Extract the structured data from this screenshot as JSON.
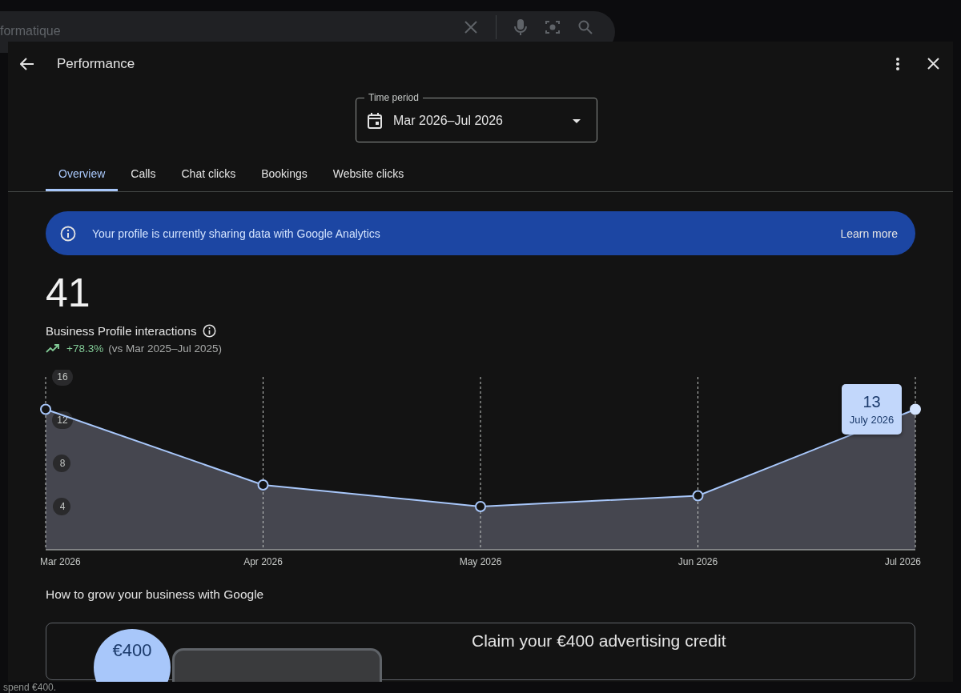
{
  "background": {
    "search_field": {
      "value": "formatique"
    },
    "footer_text": "spend €400."
  },
  "dialog": {
    "title": "Performance",
    "time_period": {
      "label": "Time period",
      "value": "Mar 2026–Jul 2026"
    },
    "tabs": [
      {
        "label": "Overview",
        "selected": true
      },
      {
        "label": "Calls",
        "selected": false
      },
      {
        "label": "Chat clicks",
        "selected": false
      },
      {
        "label": "Bookings",
        "selected": false
      },
      {
        "label": "Website clicks",
        "selected": false
      }
    ],
    "banner": {
      "text": "Your profile is currently sharing data with Google Analytics",
      "action": "Learn more"
    },
    "total": "41",
    "metric_label": "Business Profile interactions",
    "trend": {
      "change": "+78.3%",
      "comparison": "(vs Mar 2025–Jul 2025)"
    },
    "chart_data": {
      "type": "area",
      "categories": [
        "Mar 2026",
        "Apr 2026",
        "May 2026",
        "Jun 2026",
        "Jul 2026"
      ],
      "series": [
        {
          "color": "#a8c7fa",
          "values": [
            13,
            6,
            4,
            5,
            13
          ]
        }
      ],
      "ylim": [
        0,
        16
      ],
      "yticks": [
        4,
        8,
        12,
        16
      ],
      "grid": true
    },
    "chart_points": [
      {
        "selected": false
      },
      {
        "selected": false
      },
      {
        "selected": false
      },
      {
        "selected": false
      },
      {
        "selected": true
      }
    ],
    "chart_tooltip": {
      "value": "13",
      "label": "July 2026"
    },
    "grow_heading": "How to grow your business with Google",
    "promo": {
      "badge": "€400",
      "title": "Claim your €400 advertising credit"
    }
  }
}
